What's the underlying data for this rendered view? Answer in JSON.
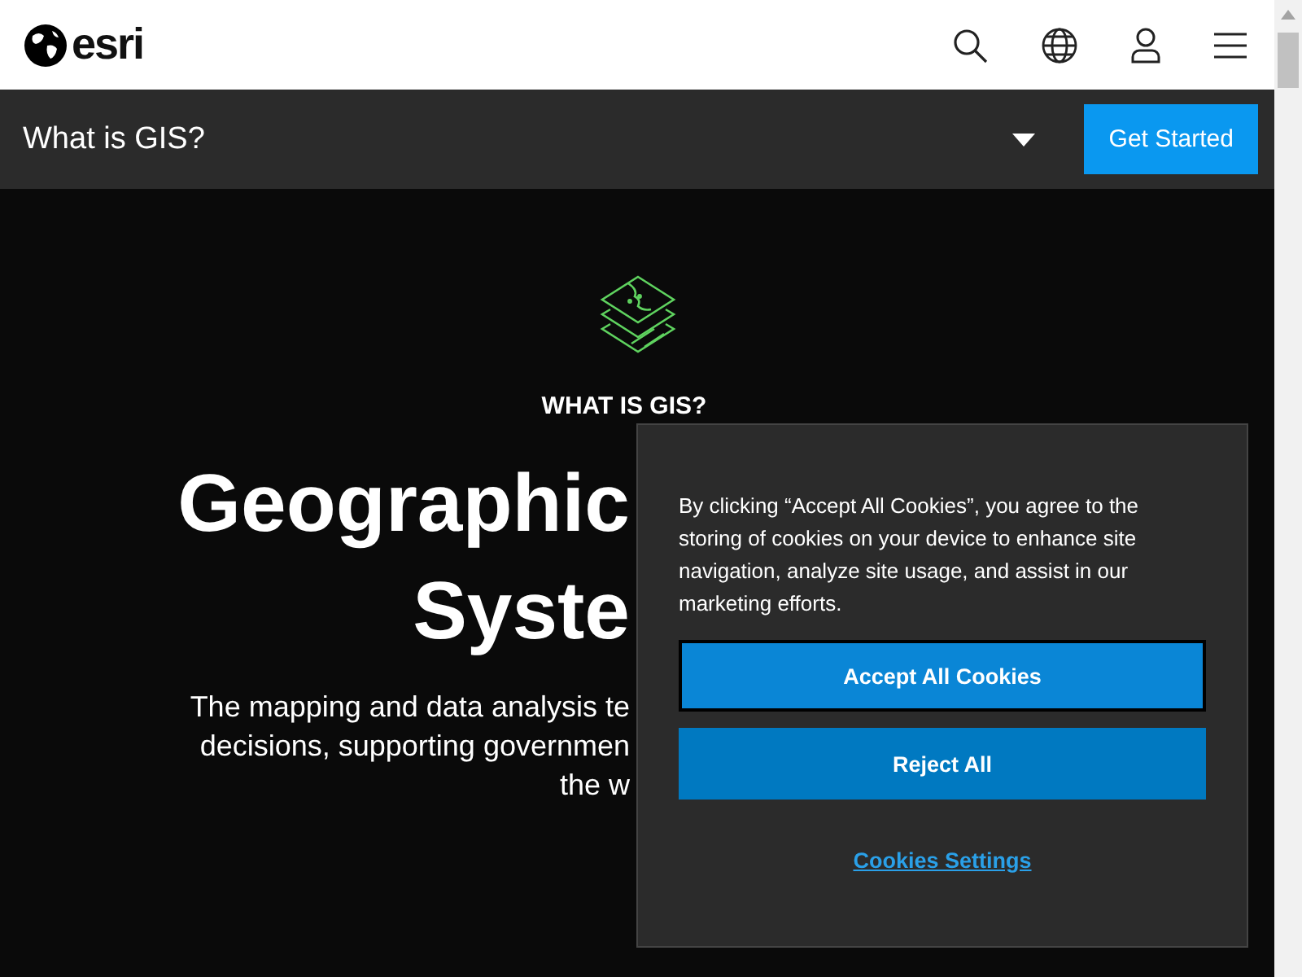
{
  "header": {
    "logo": "esri"
  },
  "subnav": {
    "title": "What is GIS?",
    "cta": "Get Started"
  },
  "hero": {
    "eyebrow": "WHAT IS GIS?",
    "heading_lines": [
      "Geographic",
      "Syste"
    ],
    "body_lines": [
      "The mapping and data analysis te",
      "decisions, supporting governmen",
      "the w"
    ]
  },
  "cookie_banner": {
    "text": "By clicking “Accept All Cookies”, you agree to the storing of cookies on your device to enhance site navigation, analyze site usage, and assist in our marketing efforts.",
    "buttons": [
      {
        "label": "Accept All Cookies",
        "kind": "primary",
        "selected": true
      },
      {
        "label": "Reject All",
        "kind": "primary",
        "selected": false
      },
      {
        "label": "Cookies Settings",
        "kind": "link",
        "selected": false
      }
    ]
  }
}
